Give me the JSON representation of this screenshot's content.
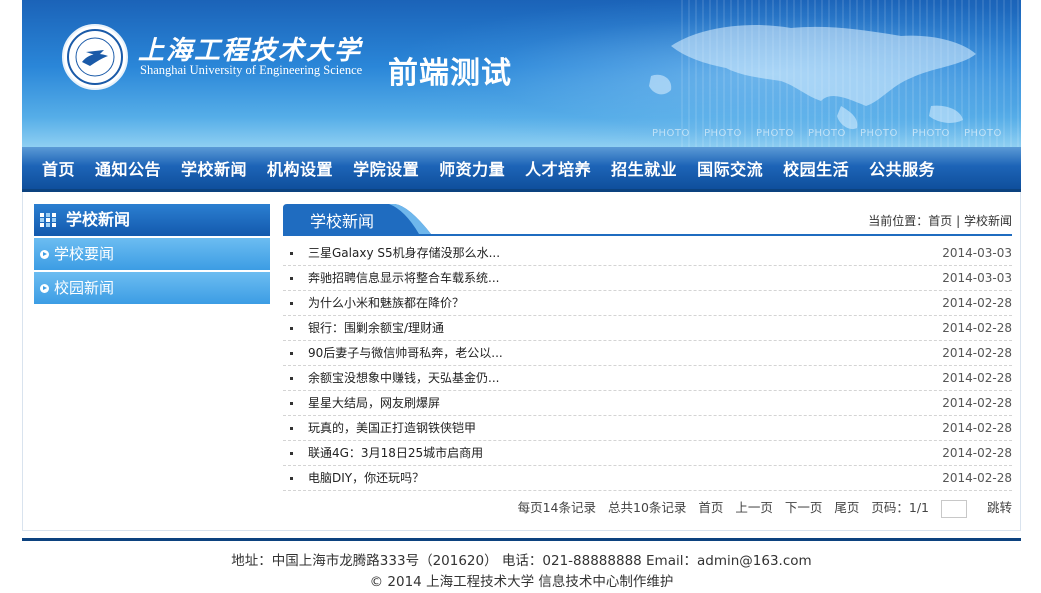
{
  "header": {
    "school_name_cn": "上海工程技术大学",
    "school_name_en": "Shanghai University of Engineering Science",
    "site_title": "前端测试",
    "photo_label": "PHOTO",
    "photo_count": 7
  },
  "nav": {
    "items": [
      "首页",
      "通知公告",
      "学校新闻",
      "机构设置",
      "学院设置",
      "师资力量",
      "人才培养",
      "招生就业",
      "国际交流",
      "校园生活",
      "公共服务"
    ]
  },
  "sidebar": {
    "title": "学校新闻",
    "items": [
      "学校要闻",
      "校园新闻"
    ]
  },
  "main": {
    "title": "学校新闻",
    "breadcrumb_prefix": "当前位置：",
    "breadcrumb_home": "首页",
    "breadcrumb_sep": "|",
    "breadcrumb_current": "学校新闻",
    "articles": [
      {
        "title": "三星Galaxy S5机身存储没那么水...",
        "date": "2014-03-03"
      },
      {
        "title": "奔驰招聘信息显示将整合车载系统...",
        "date": "2014-03-03"
      },
      {
        "title": "为什么小米和魅族都在降价？",
        "date": "2014-02-28"
      },
      {
        "title": "银行：围剿余额宝/理财通",
        "date": "2014-02-28"
      },
      {
        "title": "90后妻子与微信帅哥私奔，老公以...",
        "date": "2014-02-28"
      },
      {
        "title": "余额宝没想象中赚钱，天弘基金仍...",
        "date": "2014-02-28"
      },
      {
        "title": "星星大结局，网友刷爆屏",
        "date": "2014-02-28"
      },
      {
        "title": "玩真的，美国正打造钢铁侠铠甲",
        "date": "2014-02-28"
      },
      {
        "title": "联通4G：3月18日25城市启商用",
        "date": "2014-02-28"
      },
      {
        "title": "电脑DIY，你还玩吗？",
        "date": "2014-02-28"
      }
    ]
  },
  "pager": {
    "per_page": "每页14条记录",
    "total": "总共10条记录",
    "first": "首页",
    "prev": "上一页",
    "next": "下一页",
    "last": "尾页",
    "page_info": "页码：1/1",
    "jump_value": "",
    "jump": "跳转"
  },
  "footer": {
    "address": "地址：中国上海市龙腾路333号（201620） 电话：021-88888888 Email：admin@163.com",
    "copyright": "© 2014 上海工程技术大学 信息技术中心制作维护"
  },
  "colors": {
    "header_blue": "#1b63b8",
    "nav_blue": "#1d64b7",
    "sidebar_item": "#3c9de4",
    "tab_blue": "#1f6cc0"
  }
}
